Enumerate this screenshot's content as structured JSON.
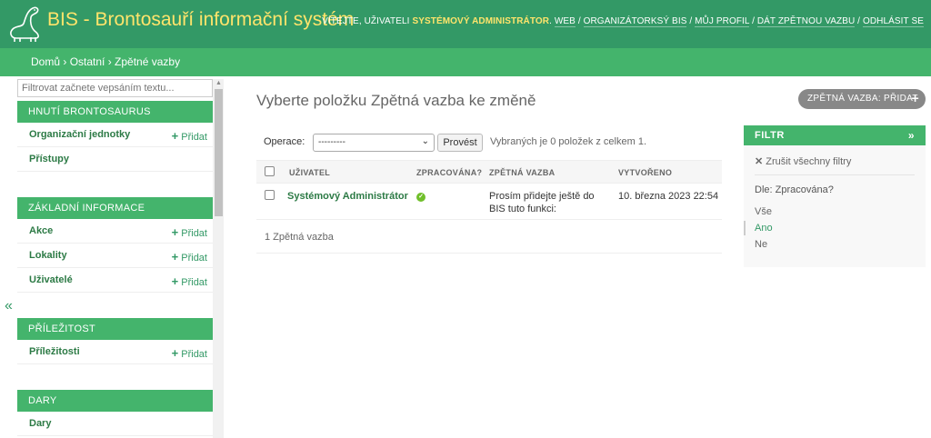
{
  "header": {
    "title": "BIS - Brontosauří informační systém",
    "welcome": "VÍTEJTE, UŽIVATELI",
    "username": "SYSTÉMOVÝ ADMINISTRÁTOR",
    "links": [
      "WEB",
      "ORGANIZÁTORKSÝ BIS",
      "MŮJ PROFIL",
      "DÁT ZPĚTNOU VAZBU",
      "ODHLÁSIT SE"
    ]
  },
  "breadcrumbs": [
    "Domů",
    "Ostatní",
    "Zpětné vazby"
  ],
  "sidebar": {
    "filter_placeholder": "Filtrovat začnete vepsáním textu...",
    "add_label": "Přidat",
    "sections": [
      {
        "caption": "HNUTÍ BRONTOSAURUS",
        "rows": [
          {
            "name": "Organizační jednotky",
            "add": true
          },
          {
            "name": "Přístupy",
            "add": false
          }
        ]
      },
      {
        "caption": "ZÁKLADNÍ INFORMACE",
        "rows": [
          {
            "name": "Akce",
            "add": true
          },
          {
            "name": "Lokality",
            "add": true
          },
          {
            "name": "Uživatelé",
            "add": true
          }
        ]
      },
      {
        "caption": "PŘÍLEŽITOST",
        "rows": [
          {
            "name": "Příležitosti",
            "add": true
          }
        ]
      },
      {
        "caption": "DARY",
        "rows": [
          {
            "name": "Dary",
            "add": false
          }
        ]
      }
    ],
    "collapse_glyph": "«"
  },
  "main": {
    "title": "Vyberte položku Zpětná vazba ke změně",
    "add_button": "ZPĚTNÁ VAZBA: PŘIDAT",
    "actions": {
      "label": "Operace:",
      "selected": "---------",
      "go": "Provést",
      "counter": "Vybraných je 0 položek z celkem 1."
    },
    "columns": [
      "UŽIVATEL",
      "ZPRACOVÁNA?",
      "ZPĚTNÁ VAZBA",
      "VYTVOŘENO"
    ],
    "rows": [
      {
        "user": "Systémový Administrátor",
        "processed": true,
        "feedback": "Prosím přidejte ještě do BIS tuto funkci:",
        "created": "10. března 2023 22:54"
      }
    ],
    "paginator": "1 Zpětná vazba"
  },
  "filter": {
    "title": "FILTR",
    "clear": "Zrušit všechny filtry",
    "by": "Dle: Zpracována?",
    "options": [
      "Vše",
      "Ano",
      "Ne"
    ],
    "selected_option": "Ano"
  },
  "colors": {
    "header": "#339966",
    "accent": "#44b46c",
    "title_yellow": "#ffe46b"
  }
}
